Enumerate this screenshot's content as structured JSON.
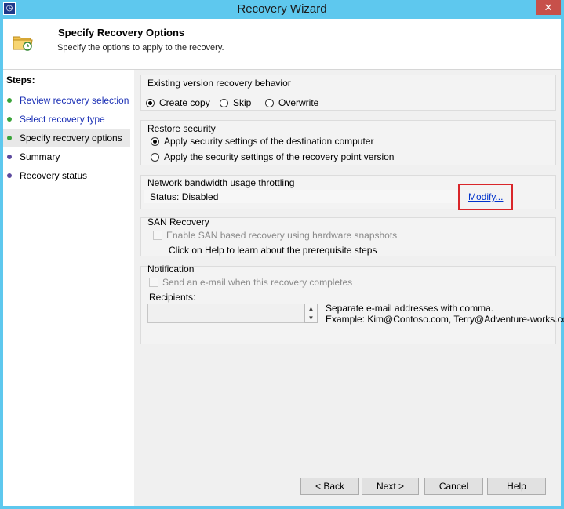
{
  "window": {
    "title": "Recovery Wizard",
    "close_glyph": "✕",
    "app_icon_glyph": "◷"
  },
  "header": {
    "title": "Specify Recovery Options",
    "subtitle": "Specify the options to apply to the recovery."
  },
  "steps": {
    "title": "Steps:",
    "items": [
      {
        "label": "Review recovery selection",
        "state": "completed",
        "color": "#3aa43a"
      },
      {
        "label": "Select recovery type",
        "state": "completed",
        "color": "#3aa43a"
      },
      {
        "label": "Specify recovery options",
        "state": "current",
        "color": "#3aa43a"
      },
      {
        "label": "Summary",
        "state": "pending",
        "color": "#5c4a9e"
      },
      {
        "label": "Recovery status",
        "state": "pending",
        "color": "#5c4a9e"
      }
    ]
  },
  "existing_version": {
    "label": "Existing version recovery behavior",
    "options": [
      {
        "label": "Create copy",
        "selected": true
      },
      {
        "label": "Skip",
        "selected": false
      },
      {
        "label": "Overwrite",
        "selected": false
      }
    ]
  },
  "restore_security": {
    "label": "Restore security",
    "options": [
      {
        "label": "Apply security settings of the destination computer",
        "selected": true
      },
      {
        "label": "Apply the security settings of the recovery point version",
        "selected": false
      }
    ]
  },
  "bandwidth": {
    "label": "Network bandwidth usage throttling",
    "status": "Status: Disabled",
    "modify_link": "Modify..."
  },
  "san": {
    "label": "SAN Recovery",
    "checkbox_label": "Enable SAN based recovery using hardware snapshots",
    "checked": false,
    "help_text": "Click on Help to learn about the prerequisite steps"
  },
  "notification": {
    "label": "Notification",
    "checkbox_label": "Send an e-mail when this recovery completes",
    "checked": false,
    "recipients_label": "Recipients:",
    "recipients_value": "",
    "hint_line1": "Separate e-mail addresses with comma.",
    "hint_line2": "Example: Kim@Contoso.com, Terry@Adventure-works.com"
  },
  "buttons": {
    "back": "< Back",
    "next": "Next >",
    "cancel": "Cancel",
    "help": "Help"
  },
  "colors": {
    "titlebar": "#5ec8ee",
    "link": "#0033cc",
    "highlight": "#d9262a"
  }
}
